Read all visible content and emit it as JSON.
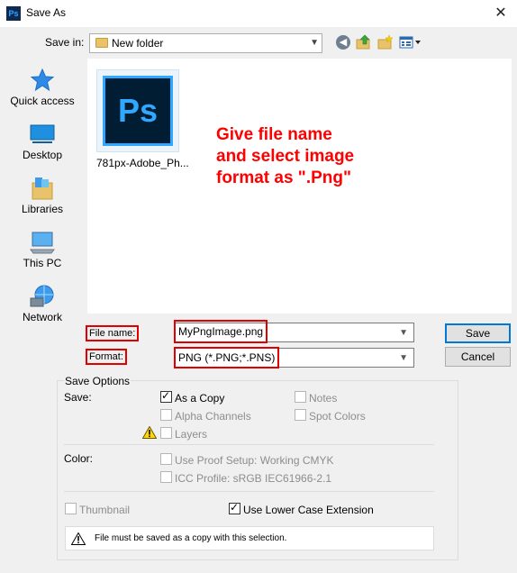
{
  "window": {
    "title": "Save As",
    "app_icon_text": "Ps",
    "close_glyph": "✕"
  },
  "toolbar": {
    "save_in_label": "Save in:",
    "save_in_value": "New folder",
    "icons": [
      "back-icon",
      "up-folder-icon",
      "new-folder-icon",
      "view-menu-icon"
    ]
  },
  "places": [
    {
      "label": "Quick access",
      "icon": "star-icon"
    },
    {
      "label": "Desktop",
      "icon": "desktop-icon"
    },
    {
      "label": "Libraries",
      "icon": "libraries-icon"
    },
    {
      "label": "This PC",
      "icon": "computer-icon"
    },
    {
      "label": "Network",
      "icon": "network-icon"
    }
  ],
  "files": [
    {
      "name": "781px-Adobe_Ph...",
      "thumb_text": "Ps"
    }
  ],
  "annotation": "Give file name\nand select image\nformat as \".Png\"",
  "form": {
    "file_name_label": "File name:",
    "file_name_value": "MyPngImage.png",
    "format_label": "Format:",
    "format_value": "PNG (*.PNG;*.PNS)",
    "save_button": "Save",
    "cancel_button": "Cancel"
  },
  "save_options": {
    "title": "Save Options",
    "save_label": "Save:",
    "as_a_copy": {
      "label": "As a Copy",
      "checked": true
    },
    "notes": {
      "label": "Notes",
      "checked": false
    },
    "alpha_channels": {
      "label": "Alpha Channels",
      "checked": false
    },
    "spot_colors": {
      "label": "Spot Colors",
      "checked": false
    },
    "layers": {
      "label": "Layers",
      "checked": false
    },
    "color_label": "Color:",
    "use_proof_setup": {
      "label": "Use Proof Setup:  Working CMYK",
      "checked": false
    },
    "icc_profile": {
      "label": "ICC Profile:  sRGB IEC61966-2.1",
      "checked": false
    },
    "thumbnail": {
      "label": "Thumbnail",
      "checked": false
    },
    "lower_case_ext": {
      "label": "Use Lower Case Extension",
      "checked": true
    },
    "message": "File must be saved as a copy with this selection."
  },
  "colors": {
    "annotation_red": "#ff0000",
    "highlight_border": "#e00000",
    "default_button_border": "#0078d7"
  }
}
